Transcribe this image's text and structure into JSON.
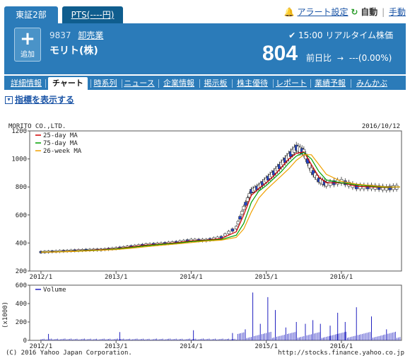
{
  "market_tabs": {
    "active": "東証2部",
    "inactive": "PTS(----円)"
  },
  "top_links": {
    "alert": "アラート設定",
    "auto": "自動",
    "sep": "|",
    "manual": "手動"
  },
  "stock": {
    "add_label": "追加",
    "code": "9837",
    "industry": "卸売業",
    "name": "モリト(株)",
    "realtime": "15:00 リアルタイム株価",
    "price": "804",
    "change_label": "前日比",
    "change_value": "---(0.00%)"
  },
  "tabs": [
    "詳細情報",
    "チャート",
    "時系列",
    "ニュース",
    "企業情報",
    "掲示板",
    "株主優待",
    "レポート",
    "業績予報",
    "みんかぶ"
  ],
  "active_tab": "チャート",
  "indicator_link": "指標を表示する",
  "chart": {
    "company": "MORITO CO.,LTD.",
    "date": "2016/10/12",
    "copyright": "(C) 2016 Yahoo Japan Corporation.",
    "url": "http://stocks.finance.yahoo.co.jp",
    "unit_label": "(x1000)"
  },
  "chart_data": [
    {
      "type": "line",
      "title": "MORITO CO.,LTD.",
      "x_ticks": [
        "2012/1",
        "2013/1",
        "2014/1",
        "2015/1",
        "2016/1"
      ],
      "ylim": [
        200,
        1200
      ],
      "y_ticks": [
        200,
        400,
        600,
        800,
        1000,
        1200
      ],
      "grid": false,
      "legend_position": "top-left",
      "series": [
        {
          "name": "25-day MA",
          "color": "#d00000"
        },
        {
          "name": "75-day MA",
          "color": "#00a000"
        },
        {
          "name": "26-week MA",
          "color": "#f0a000"
        }
      ],
      "price_x": [
        2012.0,
        2012.2,
        2012.4,
        2012.6,
        2012.8,
        2013.0,
        2013.2,
        2013.4,
        2013.6,
        2013.8,
        2014.0,
        2014.2,
        2014.4,
        2014.6,
        2014.7,
        2014.8,
        2014.9,
        2015.0,
        2015.1,
        2015.2,
        2015.3,
        2015.4,
        2015.5,
        2015.6,
        2015.7,
        2015.8,
        2016.0,
        2016.2,
        2016.4,
        2016.6,
        2016.78
      ],
      "price_y": [
        335,
        340,
        345,
        350,
        352,
        362,
        375,
        388,
        395,
        405,
        420,
        420,
        440,
        510,
        650,
        770,
        800,
        850,
        900,
        960,
        1020,
        1080,
        1050,
        920,
        850,
        820,
        840,
        800,
        800,
        790,
        800
      ],
      "ma25_y": [
        335,
        338,
        343,
        348,
        352,
        360,
        372,
        385,
        393,
        402,
        415,
        420,
        432,
        480,
        600,
        740,
        790,
        830,
        880,
        940,
        1000,
        1040,
        1050,
        960,
        870,
        830,
        830,
        805,
        800,
        795,
        800
      ],
      "ma75_y": [
        335,
        337,
        341,
        346,
        350,
        357,
        368,
        380,
        390,
        398,
        410,
        418,
        425,
        455,
        540,
        690,
        770,
        810,
        860,
        910,
        970,
        1020,
        1045,
        1000,
        910,
        850,
        830,
        815,
        805,
        797,
        800
      ],
      "ma26w_y": [
        335,
        336,
        339,
        343,
        348,
        353,
        362,
        373,
        384,
        393,
        403,
        414,
        420,
        440,
        500,
        620,
        720,
        780,
        830,
        880,
        930,
        990,
        1030,
        1030,
        960,
        890,
        840,
        820,
        810,
        800,
        800
      ]
    },
    {
      "type": "bar",
      "title": "Volume",
      "unit": "(x1000)",
      "ylim": [
        0,
        600
      ],
      "y_ticks": [
        0,
        200,
        400,
        600
      ],
      "x_ticks": [
        "2012/1",
        "2013/1",
        "2014/1",
        "2015/1",
        "2016/1"
      ],
      "series": [
        {
          "name": "Volume",
          "color": "#2020c0"
        }
      ],
      "spikes_x": [
        2012.1,
        2013.05,
        2014.03,
        2014.55,
        2014.72,
        2014.82,
        2014.92,
        2015.02,
        2015.12,
        2015.26,
        2015.4,
        2015.52,
        2015.62,
        2015.72,
        2015.85,
        2015.95,
        2016.05,
        2016.2,
        2016.4,
        2016.6
      ],
      "spikes_y": [
        70,
        90,
        110,
        80,
        120,
        520,
        180,
        470,
        330,
        140,
        200,
        180,
        220,
        180,
        160,
        300,
        200,
        360,
        260,
        120
      ]
    }
  ]
}
